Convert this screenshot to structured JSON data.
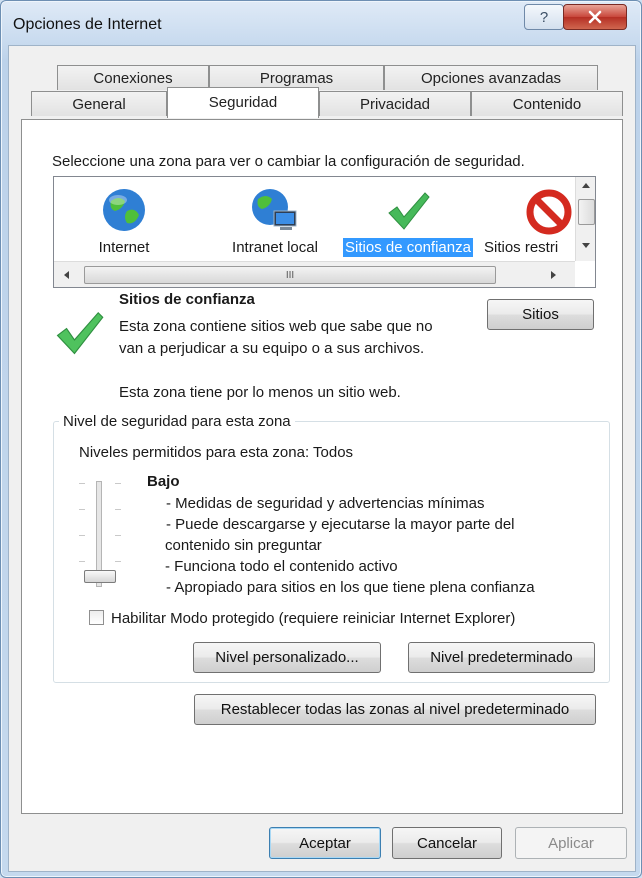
{
  "window": {
    "title": "Opciones de Internet",
    "help_glyph": "?",
    "close_glyph": "x"
  },
  "tabs_row1": [
    "Conexiones",
    "Programas",
    "Opciones avanzadas"
  ],
  "tabs_row2": [
    "General",
    "Seguridad",
    "Privacidad",
    "Contenido"
  ],
  "active_tab": "Seguridad",
  "security": {
    "instruction": "Seleccione una zona para ver o cambiar la configuración de seguridad.",
    "zones": [
      {
        "label": "Internet",
        "icon": "globe-icon"
      },
      {
        "label": "Intranet local",
        "icon": "intranet-globe-icon"
      },
      {
        "label": "Sitios de confianza",
        "icon": "green-check-icon",
        "selected": true
      },
      {
        "label": "Sitios restri",
        "icon": "restricted-icon"
      }
    ],
    "hscroll_grip": "III",
    "zone_title": "Sitios de confianza",
    "zone_desc_line1": "Esta zona contiene sitios web que sabe que no",
    "zone_desc_line2": "van a perjudicar a su equipo o a sus archivos.",
    "zone_note": "Esta zona tiene por lo menos un sitio web.",
    "sites_button": "Sitios",
    "level_group_label": "Nivel de seguridad para esta zona",
    "allowed_levels": "Niveles permitidos para esta zona: Todos",
    "level_name": "Bajo",
    "level_bullets": [
      "- Medidas de seguridad y advertencias mínimas",
      "- Puede descargarse y ejecutarse la mayor parte del",
      "contenido sin preguntar",
      "- Funciona todo el contenido activo",
      "- Apropiado para sitios en los que tiene plena confianza"
    ],
    "slider_level": 0,
    "protected_mode_label": "Habilitar Modo protegido (requiere reiniciar Internet Explorer)",
    "protected_mode_checked": false,
    "custom_level_button": "Nivel personalizado...",
    "default_level_button": "Nivel predeterminado",
    "reset_all_button": "Restablecer todas las zonas al nivel predeterminado"
  },
  "footer": {
    "ok": "Aceptar",
    "cancel": "Cancelar",
    "apply": "Aplicar"
  },
  "colors": {
    "selection": "#3399ff",
    "check_green": "#46b95a",
    "restricted_red": "#d42a1f"
  }
}
